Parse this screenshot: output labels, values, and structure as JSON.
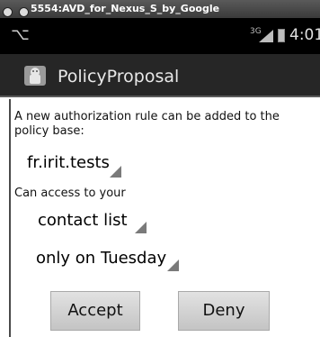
{
  "window": {
    "title": "5554:AVD_for_Nexus_S_by_Google"
  },
  "status_bar": {
    "network": "3G",
    "time": "4:01"
  },
  "action_bar": {
    "title": "PolicyProposal"
  },
  "form": {
    "intro": "A new authorization rule can be added to the policy base:",
    "subject": "fr.irit.tests",
    "access_label": "Can access to your",
    "resource": "contact  list",
    "condition": "only on Tuesday"
  },
  "buttons": {
    "accept": "Accept",
    "deny": "Deny"
  }
}
